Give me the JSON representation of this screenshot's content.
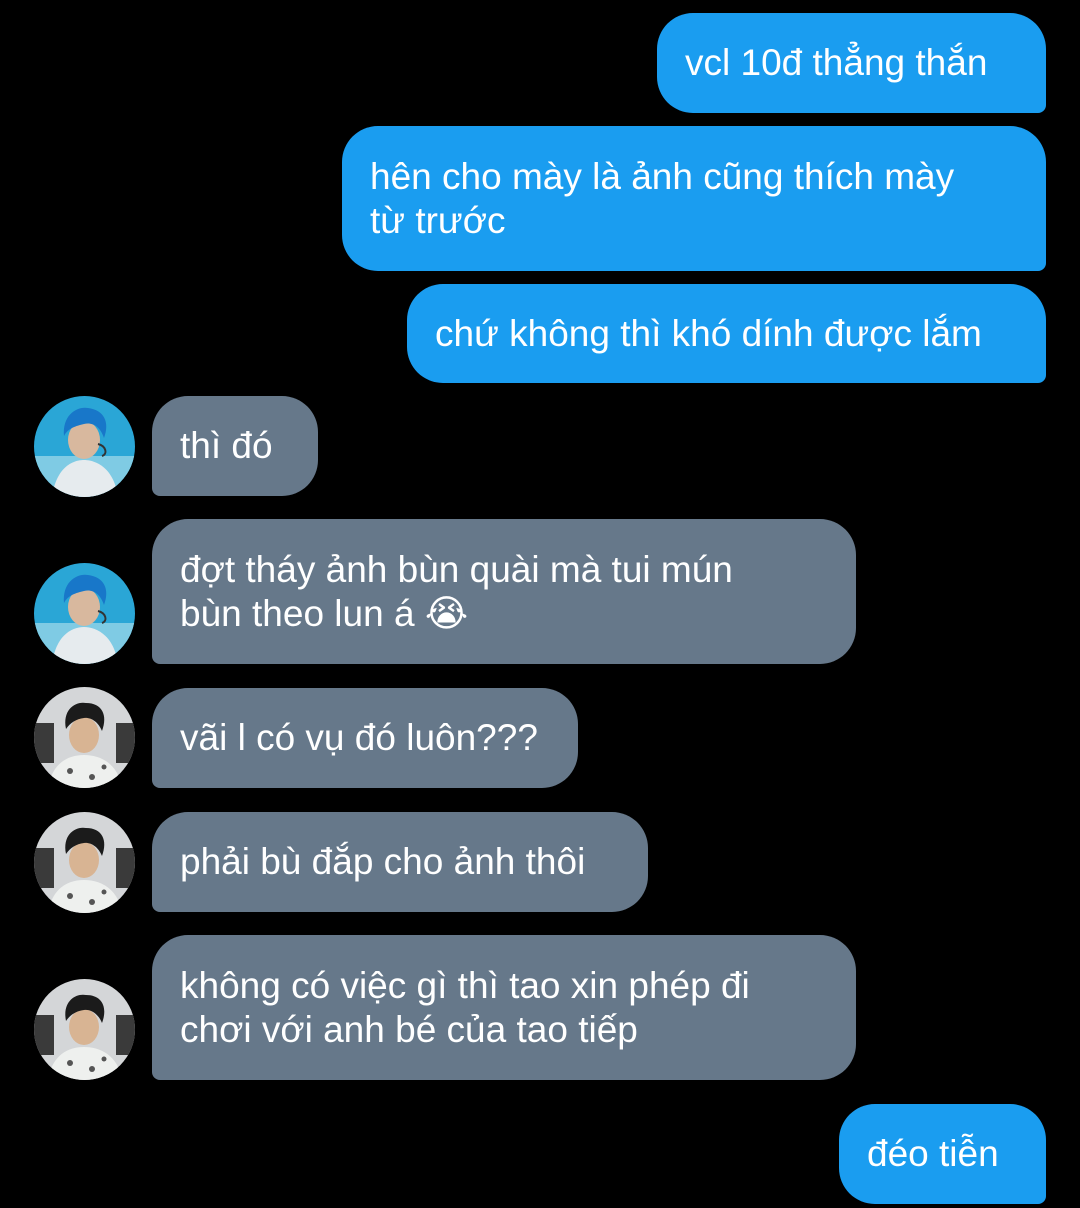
{
  "messages": [
    {
      "side": "out",
      "text": "vcl 10đ thẳng thắn"
    },
    {
      "side": "out",
      "text": "hên cho mày là ảnh cũng thích mày\ntừ trước"
    },
    {
      "side": "out",
      "text": "chứ không thì khó dính được lắm"
    },
    {
      "side": "in",
      "sender_avatar": "blue-hair-avatar",
      "text": "thì đó"
    },
    {
      "side": "in",
      "sender_avatar": "blue-hair-avatar",
      "text": "đợt tháy ảnh bùn quài mà tui mún\nbùn theo lun á",
      "emoji": "😭"
    },
    {
      "side": "in",
      "sender_avatar": "dark-hair-avatar",
      "text": "vãi l có vụ đó luôn???"
    },
    {
      "side": "in",
      "sender_avatar": "dark-hair-avatar",
      "text": "phải bù đắp cho ảnh thôi"
    },
    {
      "side": "in",
      "sender_avatar": "dark-hair-avatar",
      "text": "không có việc gì thì tao xin phép đi\nchơi với anh bé của tao tiếp"
    },
    {
      "side": "out",
      "text": "đéo tiễn"
    }
  ],
  "colors": {
    "background": "#000000",
    "outgoing_bubble": "#1a9df0",
    "incoming_bubble": "#66788a",
    "text": "#ffffff"
  }
}
